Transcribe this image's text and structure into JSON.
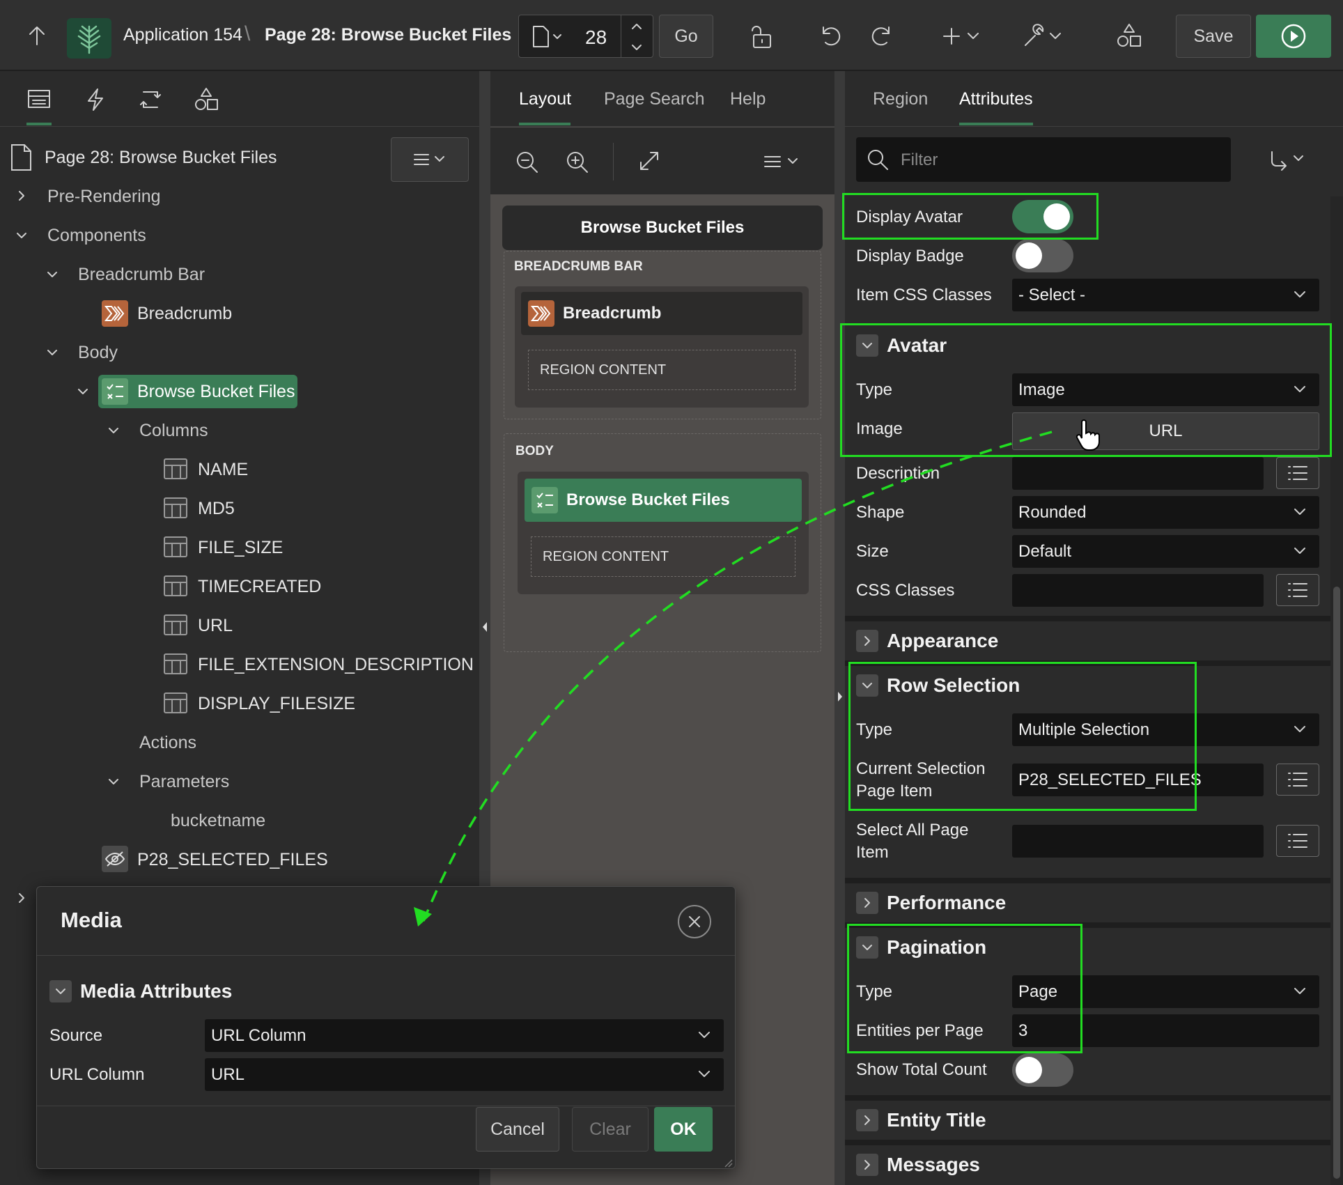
{
  "header": {
    "app": "Application 154",
    "sep": "\\",
    "page": "Page 28: Browse Bucket Files",
    "page_number": "28",
    "go": "Go",
    "save": "Save"
  },
  "left": {
    "page_title": "Page 28: Browse Bucket Files",
    "tree": {
      "pre_rendering": "Pre-Rendering",
      "components": "Components",
      "breadcrumb_bar": "Breadcrumb Bar",
      "breadcrumb": "Breadcrumb",
      "body": "Body",
      "browse": "Browse Bucket Files",
      "columns": "Columns",
      "cols": [
        "NAME",
        "MD5",
        "FILE_SIZE",
        "TIMECREATED",
        "URL",
        "FILE_EXTENSION_DESCRIPTION",
        "DISPLAY_FILESIZE"
      ],
      "actions": "Actions",
      "parameters": "Parameters",
      "bucketname": "bucketname",
      "selected_files": "P28_SELECTED_FILES"
    }
  },
  "middle": {
    "tabs": [
      "Layout",
      "Page Search",
      "Help"
    ],
    "region_title": "Browse Bucket Files",
    "breadcrumb_bar": "BREADCRUMB BAR",
    "breadcrumb": "Breadcrumb",
    "region_content": "REGION CONTENT",
    "body": "BODY",
    "browse": "Browse Bucket Files"
  },
  "right": {
    "tabs": [
      "Region",
      "Attributes"
    ],
    "filter_placeholder": "Filter",
    "display_avatar": "Display Avatar",
    "display_badge": "Display Badge",
    "item_css": "Item CSS Classes",
    "item_css_value": "- Select -",
    "avatar": {
      "title": "Avatar",
      "type_label": "Type",
      "type_value": "Image",
      "image_label": "Image",
      "image_value": "URL",
      "description": "Description",
      "shape_label": "Shape",
      "shape_value": "Rounded",
      "size_label": "Size",
      "size_value": "Default",
      "css": "CSS Classes"
    },
    "appearance": "Appearance",
    "row_selection": {
      "title": "Row Selection",
      "type_label": "Type",
      "type_value": "Multiple Selection",
      "current_label_1": "Current Selection",
      "current_label_2": "Page Item",
      "current_value": "P28_SELECTED_FILES",
      "select_all_1": "Select All Page",
      "select_all_2": "Item"
    },
    "performance": "Performance",
    "pagination": {
      "title": "Pagination",
      "type_label": "Type",
      "type_value": "Page",
      "entities_label": "Entities per Page",
      "entities_value": "3",
      "show_total": "Show Total Count"
    },
    "entity_title": "Entity Title",
    "messages": "Messages",
    "toggles": {
      "display_avatar": true,
      "display_badge": false,
      "show_total_count": false
    }
  },
  "dialog": {
    "title": "Media",
    "section": "Media Attributes",
    "source_label": "Source",
    "source_value": "URL Column",
    "urlcol_label": "URL Column",
    "urlcol_value": "URL",
    "cancel": "Cancel",
    "clear": "Clear",
    "ok": "OK"
  },
  "colors": {
    "accent_green": "#3a7d56",
    "highlight": "#22dd22",
    "field_bg": "#141414",
    "panel_bg": "#2b2b2b"
  }
}
